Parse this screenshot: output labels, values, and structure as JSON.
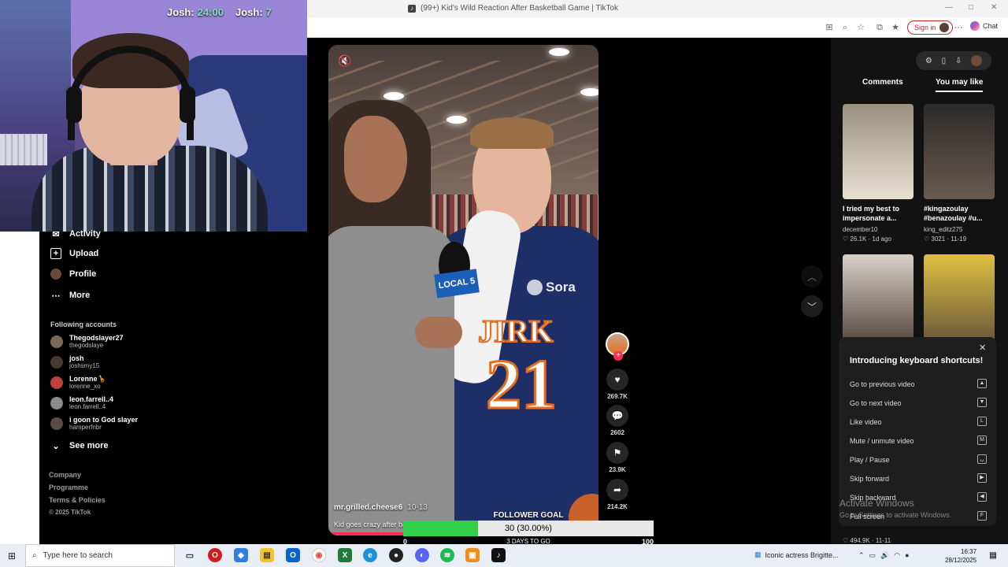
{
  "browser": {
    "tab_title": "(99+) Kid's Wild Reaction After Basketball Game | TikTok",
    "signin_label": "Sign in",
    "chat_label": "Chat"
  },
  "webcam": {
    "overlay_left": "Josh:",
    "overlay_left_value": "24:00",
    "overlay_right": "Josh:",
    "overlay_right_value": "7"
  },
  "sidebar": {
    "nav": [
      {
        "label": "Activity",
        "icon": "activity-icon"
      },
      {
        "label": "Upload",
        "icon": "upload-icon"
      },
      {
        "label": "Profile",
        "icon": "profile-icon"
      },
      {
        "label": "More",
        "icon": "more-icon"
      }
    ],
    "following_header": "Following accounts",
    "following": [
      {
        "name": "Thegodslayer27",
        "handle": "thegodslaye"
      },
      {
        "name": "josh",
        "handle": "joshsmy15"
      },
      {
        "name": "Lorenne🦒",
        "handle": "lorenne_xo"
      },
      {
        "name": "leon.farrell..4",
        "handle": "leon.farrell..4"
      },
      {
        "name": "i goon to God slayer",
        "handle": "hamperfnbr"
      }
    ],
    "see_more": "See more",
    "footer": [
      "Company",
      "Programme",
      "Terms & Policies",
      "© 2025 TikTok"
    ]
  },
  "video": {
    "author": "mr.grilled.cheese6",
    "date": "10-13",
    "description": "Kid goes crazy after ba",
    "progress": 0.3,
    "jersey_text": "JIRK",
    "jersey_number": "21",
    "mic_label": "LOCAL 5",
    "watermark": "Sora"
  },
  "rail": {
    "likes": "269.7K",
    "comments": "2602",
    "saves": "23.9K",
    "shares": "214.2K"
  },
  "goal": {
    "title": "FOLLOWER GOAL",
    "value": "30 (30.00%)",
    "percent": 30,
    "min": "0",
    "max": "100",
    "days": "3 DAYS TO GO"
  },
  "right_panel": {
    "tabs": [
      "Comments",
      "You may like"
    ],
    "active_tab": "You may like",
    "items": [
      {
        "title": "I tried my best to impersonate a...",
        "user": "december10",
        "likes": "26.1K",
        "date": "1d ago"
      },
      {
        "title": "#kingazoulay #benazoulay #u...",
        "user": "king_editz275",
        "likes": "3021",
        "date": "11-19"
      },
      {
        "title": "",
        "user": "",
        "likes": "",
        "date": ""
      },
      {
        "title": "",
        "user": "",
        "likes": "",
        "date": ""
      }
    ],
    "bottom_stats": "494.9K · 11-11"
  },
  "shortcuts": {
    "title": "Introducing keyboard shortcuts!",
    "rows": [
      {
        "label": "Go to previous video",
        "key": "▲"
      },
      {
        "label": "Go to next video",
        "key": "▼"
      },
      {
        "label": "Like video",
        "key": "L"
      },
      {
        "label": "Mute / unmute video",
        "key": "M"
      },
      {
        "label": "Play / Pause",
        "key": "␣"
      },
      {
        "label": "Skip forward",
        "key": "▶"
      },
      {
        "label": "Skip backward",
        "key": "◀"
      },
      {
        "label": "Full screen",
        "key": "F"
      }
    ],
    "activate_title": "Activate Windows",
    "activate_sub": "Go to Settings to activate Windows."
  },
  "taskbar": {
    "search_placeholder": "Type here to search",
    "news": "Iconic actress Brigitte...",
    "time": "16:37",
    "date": "28/12/2025"
  }
}
